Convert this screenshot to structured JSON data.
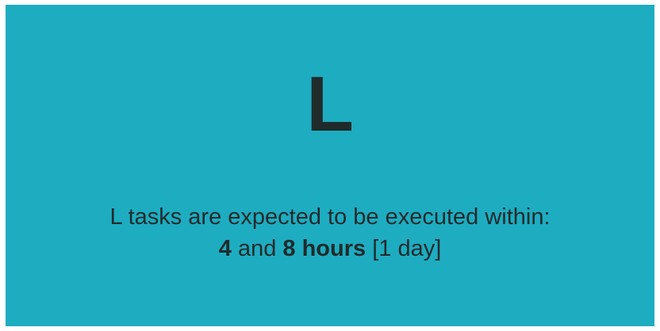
{
  "card": {
    "size_letter": "L",
    "description_line1": "L tasks are expected to be executed within:",
    "range_min": "4",
    "and_word": "and",
    "range_max": "8 hours",
    "range_note": "[1 day]",
    "background_color": "#1eacc1",
    "text_color": "#1f2b2b"
  }
}
